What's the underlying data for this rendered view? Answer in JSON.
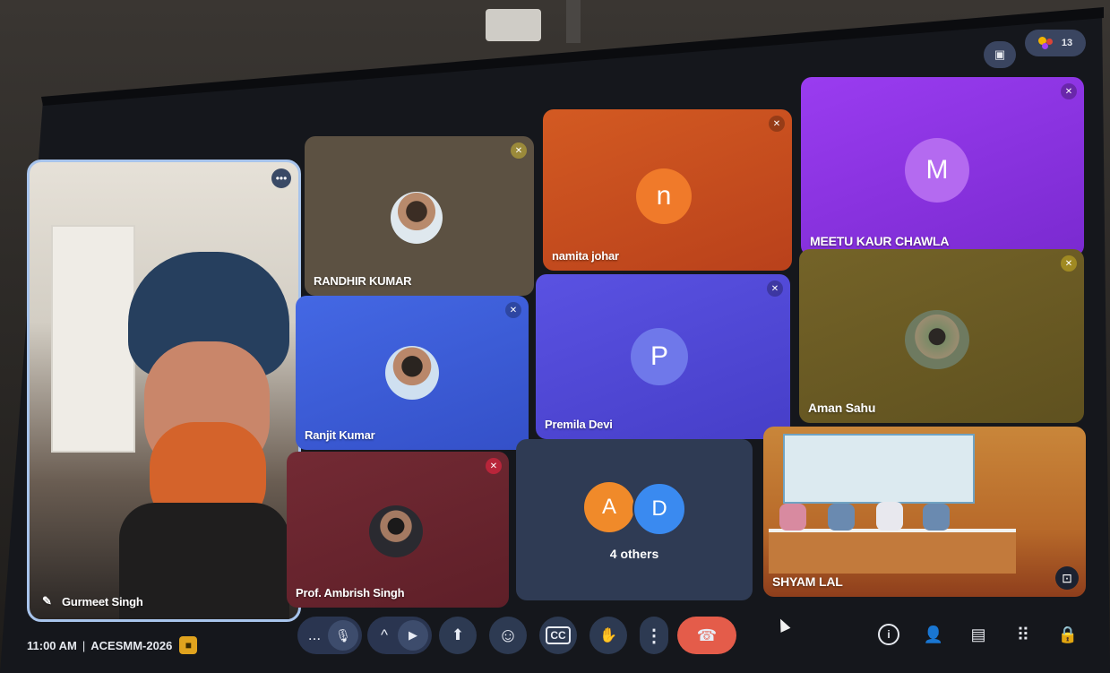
{
  "top_bar": {
    "participant_count": "13"
  },
  "participants": [
    {
      "name": "Gurmeet Singh"
    },
    {
      "name": "RANDHIR KUMAR"
    },
    {
      "name": "namita johar",
      "initial": "n"
    },
    {
      "name": "MEETU KAUR CHAWLA",
      "initial": "M"
    },
    {
      "name": "Ranjit Kumar"
    },
    {
      "name": "Premila Devi",
      "initial": "P"
    },
    {
      "name": "Aman Sahu"
    },
    {
      "name": "Prof. Ambrish Singh"
    },
    {
      "name": "SHYAM LAL"
    }
  ],
  "others_tile": {
    "label": "4 others",
    "initials": [
      "A",
      "D"
    ]
  },
  "meeting_info": {
    "time": "11:00 AM",
    "separator": "|",
    "code": "ACESMM-2026"
  },
  "controls": {
    "more_options": "...",
    "mic": "🎙",
    "expand": "^",
    "camera": "▶",
    "present": "⬆",
    "emoji": "☺",
    "captions": "CC",
    "raise_hand": "✋",
    "overflow": "⋮",
    "end_call": "☎"
  },
  "right_controls": {
    "info": "i",
    "people": "👤",
    "chat": "▤",
    "activities": "⠿",
    "host": "🔒"
  },
  "colors": {
    "randhir": "#5c5142",
    "namita": "#c8501f",
    "meetu": "#8c35e0",
    "ranjit": "#3d5fd8",
    "premila": "#4f48d6",
    "aman": "#6a5a22",
    "ambrish": "#6c2530",
    "others": "#2f3b54",
    "end_call": "#e45c4a"
  }
}
